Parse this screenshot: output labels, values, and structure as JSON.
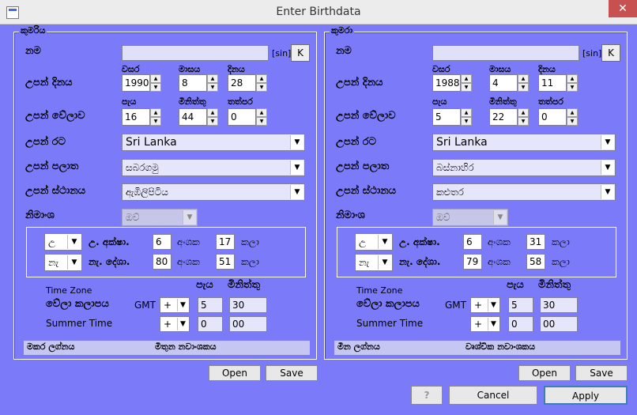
{
  "window": {
    "title": "Enter Birthdata",
    "close_symbol": "✕"
  },
  "panels": [
    {
      "title": "කුමරිය",
      "name_label": "නම",
      "name_value": "",
      "sin_label": "[sin]",
      "k_label": "K",
      "birth_date_label": "උපන් දිනය",
      "year_label": "වසර",
      "month_label": "මාසය",
      "day_label": "දිනය",
      "year": "1990",
      "month": "8",
      "day": "28",
      "birth_time_label": "උපන් වේලාව",
      "hour_label": "පැය",
      "minute_label": "මිනිත්තු",
      "second_label": "තත්පර",
      "hour": "16",
      "minute": "44",
      "second": "0",
      "country_label": "උපන් රට",
      "country": "Sri Lanka",
      "province_label": "උපන් පලාත",
      "province": "සබරගමු",
      "place_label": "උපන් ස්ථානය",
      "place": "ඇඹිලිපිටිය",
      "nimmansa_label": "නිමාංශ",
      "nimmansa": "ඔව්",
      "lat_dir": "උ",
      "lat_label": "උ. අක්ෂා.",
      "lat_deg": "6",
      "deg_label": "අංශක",
      "lat_min": "17",
      "min_label": "කලා",
      "lon_dir": "නැ",
      "lon_label": "නැ. දේශා.",
      "lon_deg": "80",
      "lon_min": "51",
      "tz_title": "Time Zone",
      "tz_hour_label": "පැය",
      "tz_min_label": "මිනිත්තු",
      "tz_label": "වේලා කලාපය",
      "gmt_label": "GMT",
      "tz_sign": "+",
      "tz_hour": "5",
      "tz_min": "30",
      "summer_label": "Summer Time",
      "summer_sign": "+",
      "summer_hour": "0",
      "summer_min": "00",
      "lagna": "මකර ලග්නය",
      "navamsa": "මිතුන නවාංශකය",
      "open_label": "Open",
      "save_label": "Save"
    },
    {
      "title": "කුමරා",
      "name_label": "නම",
      "name_value": "",
      "sin_label": "[sin]",
      "k_label": "K",
      "birth_date_label": "උපන් දිනය",
      "year_label": "වසර",
      "month_label": "මාසය",
      "day_label": "දිනය",
      "year": "1988",
      "month": "4",
      "day": "11",
      "birth_time_label": "උපන් වේලාව",
      "hour_label": "පැය",
      "minute_label": "මිනිත්තු",
      "second_label": "තත්පර",
      "hour": "5",
      "minute": "22",
      "second": "0",
      "country_label": "උපන් රට",
      "country": "Sri Lanka",
      "province_label": "උපන් පලාත",
      "province": "බස්නාහිර",
      "place_label": "උපන් ස්ථානය",
      "place": "කළුතර",
      "nimmansa_label": "නිමාංශ",
      "nimmansa": "ඔව්",
      "lat_dir": "උ",
      "lat_label": "උ. අක්ෂා.",
      "lat_deg": "6",
      "deg_label": "අංශක",
      "lat_min": "31",
      "min_label": "කලා",
      "lon_dir": "නැ",
      "lon_label": "නැ. දේශා.",
      "lon_deg": "79",
      "lon_min": "58",
      "tz_title": "Time Zone",
      "tz_hour_label": "පැය",
      "tz_min_label": "මිනිත්තු",
      "tz_label": "වේලා කලාපය",
      "gmt_label": "GMT",
      "tz_sign": "+",
      "tz_hour": "5",
      "tz_min": "30",
      "summer_label": "Summer Time",
      "summer_sign": "+",
      "summer_hour": "0",
      "summer_min": "00",
      "lagna": "මීන ලග්නය",
      "navamsa": "වෘශ්චික නවාංශකය",
      "open_label": "Open",
      "save_label": "Save"
    }
  ],
  "footer": {
    "help_label": "?",
    "cancel_label": "Cancel",
    "apply_label": "Apply"
  }
}
